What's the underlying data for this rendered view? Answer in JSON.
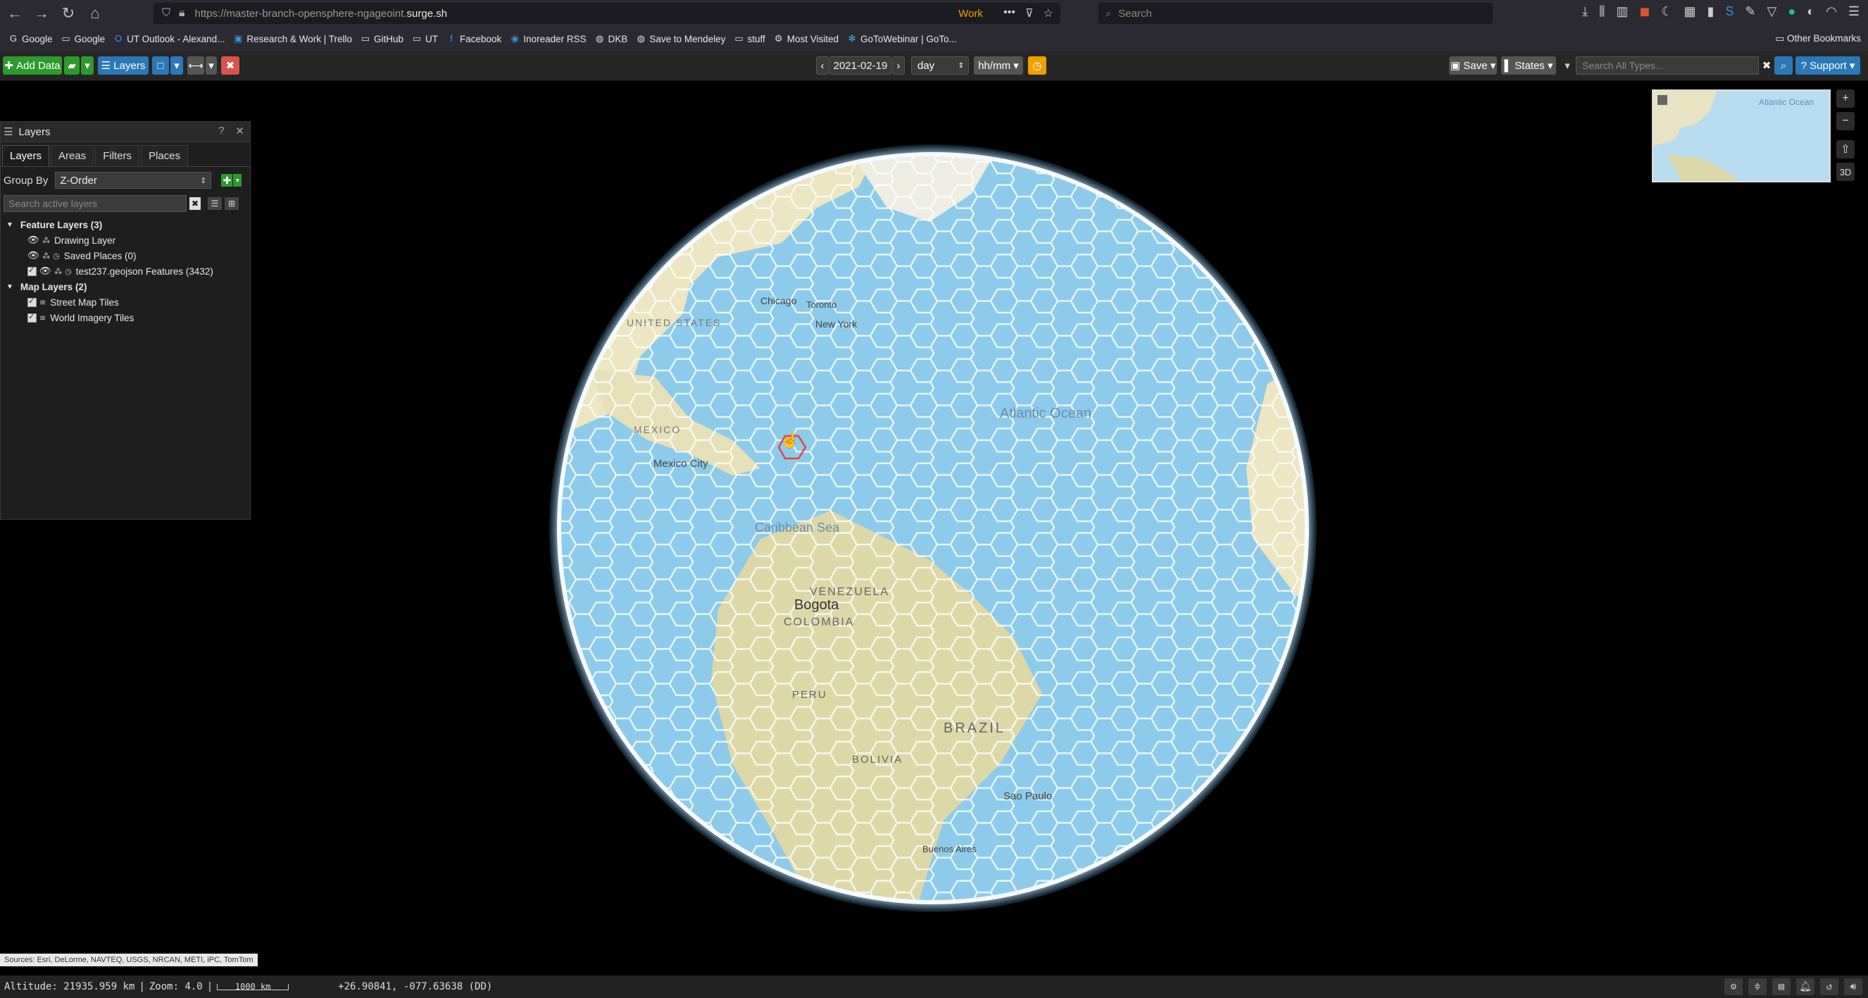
{
  "browser": {
    "url_prefix": "https://master-branch-opensphere-ngageoint.",
    "url_domain": "surge.sh",
    "container": "Work",
    "search_placeholder": "Search",
    "bookmarks": [
      "Google",
      "Google",
      "UT Outlook - Alexand...",
      "Research & Work | Trello",
      "GitHub",
      "UT",
      "Facebook",
      "Inoreader RSS",
      "DKB",
      "Save to Mendeley",
      "stuff",
      "Most Visited",
      "GoToWebinar | GoTo..."
    ],
    "other_bookmarks": "Other Bookmarks"
  },
  "toolbar": {
    "add_data": "Add Data",
    "layers": "Layers",
    "date": "2021-02-19",
    "duration": "day",
    "time_format": "hh/mm",
    "save": "Save",
    "states": "States",
    "search_placeholder": "Search All Types...",
    "support": "Support"
  },
  "layers_panel": {
    "title": "Layers",
    "help": "?",
    "tabs": [
      "Layers",
      "Areas",
      "Filters",
      "Places"
    ],
    "group_by_label": "Group By",
    "group_by_value": "Z-Order",
    "search_placeholder": "Search active layers",
    "feature_group": "Feature Layers (3)",
    "feature_layers": [
      "Drawing Layer",
      "Saved Places (0)",
      "test237.geojson Features (3432)"
    ],
    "map_group": "Map Layers (2)",
    "map_layers": [
      "Street Map Tiles",
      "World Imagery Tiles"
    ]
  },
  "map": {
    "labels": {
      "ocean": "Atlantic Ocean",
      "sea": "Caribbean Sea",
      "venezuela": "VENEZUELA",
      "colombia": "COLOMBIA",
      "bogota": "Bogota",
      "peru": "PERU",
      "brazil": "BRAZIL",
      "bolivia": "BOLIVIA",
      "sao_paulo": "Sao Paulo",
      "buenos_aires": "Buenos Aires",
      "toronto": "Toronto",
      "new_york": "New York",
      "chicago": "Chicago",
      "united_states": "UNITED STATES",
      "mexico_city": "Mexico City",
      "mexico": "MEXICO"
    },
    "minimap_label": "Atlantic Ocean",
    "view_3d": "3D",
    "credits": "Sources: Esri, DeLorme, NAVTEQ, USGS, NRCAN, METI, iPC, TomTom"
  },
  "status": {
    "altitude": "Altitude: 21935.959 km",
    "zoom": "Zoom: 4.0",
    "scale": "1000 km",
    "coordinates": "+26.90841, -077.63638 (DD)"
  },
  "colors": {
    "green": "#2c9a2c",
    "blue": "#2a78b8",
    "ocean": "#8ecbea",
    "land": "#ece6c2",
    "hex_stroke": "#ffffff",
    "highlight": "#e0473e"
  }
}
